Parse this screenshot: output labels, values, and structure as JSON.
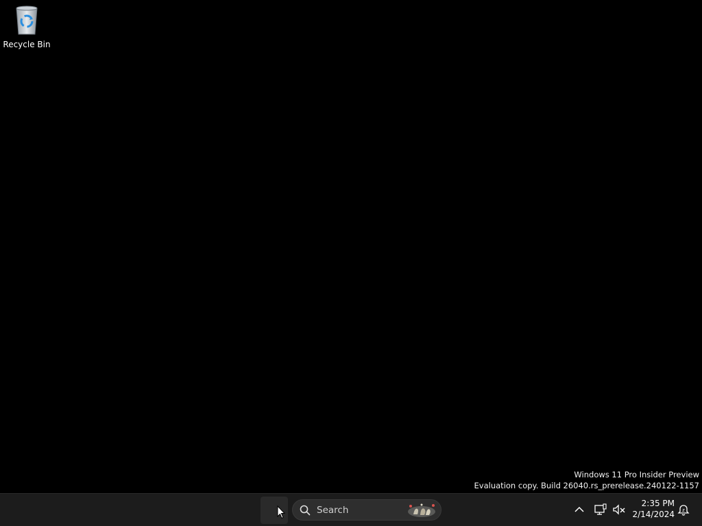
{
  "desktop": {
    "icons": [
      {
        "label": "Recycle Bin",
        "icon": "recycle-bin-icon"
      }
    ],
    "watermark": {
      "line1": "Windows 11 Pro Insider Preview",
      "line2": "Evaluation copy. Build 26040.rs_prerelease.240122-1157"
    }
  },
  "taskbar": {
    "start_icon": "windows-start-icon",
    "search": {
      "placeholder": "Search",
      "icon": "search-icon",
      "highlight_icon": "search-highlight-icon"
    },
    "tray": {
      "chevron_icon": "chevron-up-icon",
      "network_icon": "network-icon",
      "volume_icon": "volume-muted-icon",
      "time": "2:35 PM",
      "date": "2/14/2024",
      "notification_icon": "notification-bell-icon"
    }
  },
  "colors": {
    "desktop_bg": "#000000",
    "taskbar_bg": "#1c1c1c",
    "search_bg": "#2e2e2e",
    "text": "#ffffff"
  }
}
